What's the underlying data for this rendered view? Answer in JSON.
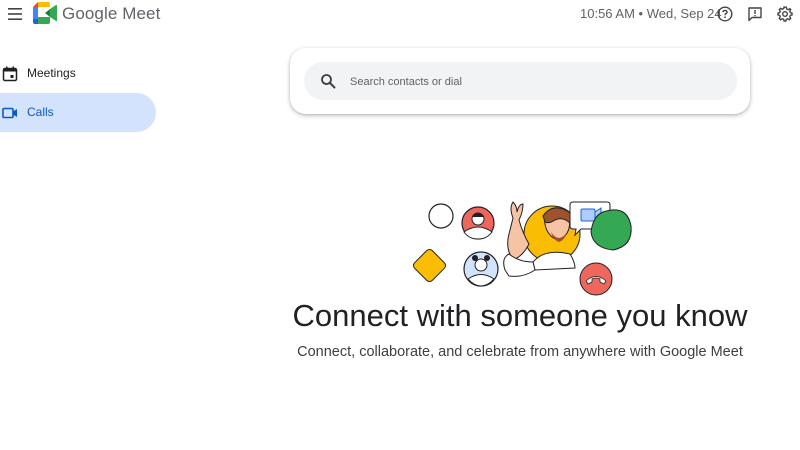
{
  "header": {
    "product_name": "Google Meet",
    "datetime": "10:56 AM • Wed, Sep 24",
    "icons": [
      "menu-icon",
      "help-icon",
      "feedback-icon",
      "settings-icon"
    ]
  },
  "sidebar": {
    "items": [
      {
        "label": "Meetings",
        "icon": "calendar-icon",
        "active": false
      },
      {
        "label": "Calls",
        "icon": "video-camera-icon",
        "active": true
      }
    ]
  },
  "search": {
    "placeholder": "Search contacts or dial",
    "value": ""
  },
  "empty_state": {
    "headline": "Connect with someone you know",
    "subline": "Connect, collaborate, and celebrate from anywhere with Google Meet"
  },
  "colors": {
    "accent": "#0b57d0",
    "active_bg": "#d3e3fd",
    "google_red": "#ea4335",
    "google_yellow": "#fbbc04",
    "google_green": "#34a853",
    "google_blue": "#4285f4"
  }
}
